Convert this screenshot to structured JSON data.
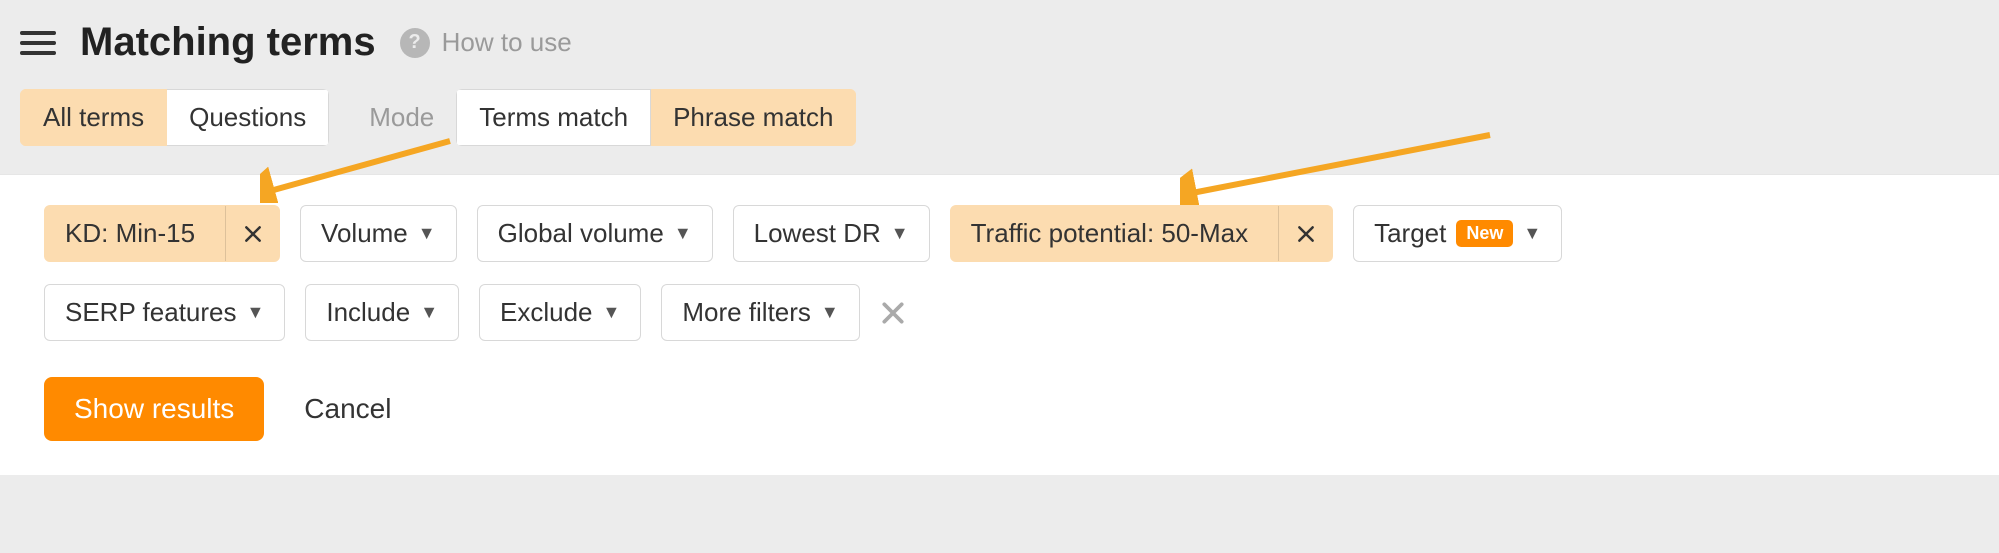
{
  "header": {
    "title": "Matching terms",
    "help_label": "How to use"
  },
  "tabs": {
    "view": [
      {
        "label": "All terms",
        "active": true
      },
      {
        "label": "Questions",
        "active": false
      }
    ],
    "mode_label": "Mode",
    "mode": [
      {
        "label": "Terms match",
        "active": false
      },
      {
        "label": "Phrase match",
        "active": true
      }
    ]
  },
  "filters": {
    "kd": {
      "label": "KD: Min-15"
    },
    "volume": {
      "label": "Volume"
    },
    "global_volume": {
      "label": "Global volume"
    },
    "lowest_dr": {
      "label": "Lowest DR"
    },
    "traffic_potential": {
      "label": "Traffic potential: 50-Max"
    },
    "target": {
      "label": "Target",
      "badge": "New"
    },
    "serp_features": {
      "label": "SERP features"
    },
    "include": {
      "label": "Include"
    },
    "exclude": {
      "label": "Exclude"
    },
    "more": {
      "label": "More filters"
    }
  },
  "actions": {
    "show": "Show results",
    "cancel": "Cancel"
  },
  "colors": {
    "accent": "#ff8a00",
    "highlight": "#fcdcb0"
  }
}
